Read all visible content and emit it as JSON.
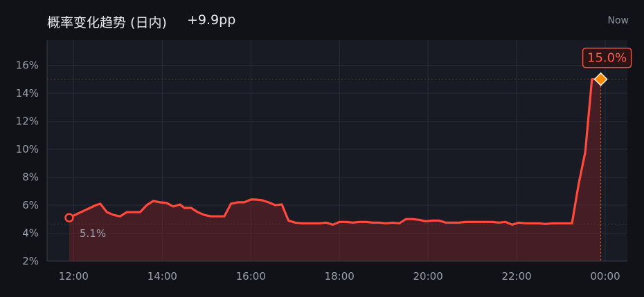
{
  "header": {
    "title": "概率变化趋势 (日内)",
    "delta": "+9.9pp",
    "now_label": "Now"
  },
  "colors": {
    "background": "#111217",
    "plot_background": "#181a24",
    "line": "#ff4a3d",
    "fill": "#7a2426",
    "end_marker": "#ff8a00",
    "grid": "#2a2d38",
    "text": "#9aa0ab"
  },
  "chart_data": {
    "type": "area",
    "title": "概率变化趋势 (日内)",
    "xlabel": "",
    "ylabel": "",
    "x_range_hours": [
      11.4,
      24.5
    ],
    "ylim": [
      2,
      17.8
    ],
    "y_ticks": [
      "2%",
      "4%",
      "6%",
      "8%",
      "10%",
      "12%",
      "14%",
      "16%"
    ],
    "y_tick_values": [
      2,
      4,
      6,
      8,
      10,
      12,
      14,
      16
    ],
    "x_ticks": [
      "12:00",
      "14:00",
      "16:00",
      "18:00",
      "20:00",
      "22:00",
      "00:00"
    ],
    "x_tick_values": [
      12,
      14,
      16,
      18,
      20,
      22,
      24
    ],
    "grid": true,
    "start_label": "5.1%",
    "end_label": "15.0%",
    "series": [
      {
        "x": [
          11.9,
          12.1,
          12.3,
          12.5,
          12.6,
          12.75,
          12.9,
          13.05,
          13.2,
          13.35,
          13.5,
          13.65,
          13.8,
          13.95,
          14.1,
          14.25,
          14.4,
          14.5,
          14.65,
          14.8,
          14.95,
          15.1,
          15.25,
          15.4,
          15.55,
          15.7,
          15.85,
          16.0,
          16.1,
          16.25,
          16.4,
          16.55,
          16.7,
          16.85,
          17.0,
          17.15,
          17.25,
          17.4,
          17.55,
          17.7,
          17.85,
          18.0,
          18.15,
          18.3,
          18.45,
          18.6,
          18.75,
          18.9,
          19.05,
          19.2,
          19.35,
          19.5,
          19.65,
          19.8,
          19.95,
          20.1,
          20.25,
          20.4,
          20.55,
          20.7,
          20.85,
          21.0,
          21.15,
          21.3,
          21.45,
          21.6,
          21.75,
          21.9,
          22.05,
          22.2,
          22.35,
          22.5,
          22.65,
          22.8,
          22.95,
          23.1,
          23.25,
          23.4,
          23.55,
          23.7,
          23.85,
          23.9
        ],
        "values": [
          5.1,
          5.4,
          5.7,
          6.0,
          6.1,
          5.5,
          5.3,
          5.2,
          5.5,
          5.5,
          5.5,
          6.0,
          6.3,
          6.2,
          6.15,
          5.9,
          6.05,
          5.8,
          5.8,
          5.5,
          5.3,
          5.2,
          5.2,
          5.2,
          6.1,
          6.2,
          6.2,
          6.4,
          6.4,
          6.35,
          6.2,
          6.0,
          6.05,
          4.9,
          4.75,
          4.7,
          4.7,
          4.7,
          4.7,
          4.75,
          4.6,
          4.8,
          4.8,
          4.75,
          4.8,
          4.8,
          4.75,
          4.75,
          4.7,
          4.75,
          4.7,
          5.0,
          5.0,
          4.95,
          4.85,
          4.9,
          4.9,
          4.75,
          4.75,
          4.75,
          4.8,
          4.8,
          4.8,
          4.8,
          4.8,
          4.75,
          4.8,
          4.6,
          4.75,
          4.7,
          4.7,
          4.7,
          4.65,
          4.7,
          4.7,
          4.7,
          4.7,
          7.5,
          9.8,
          15.0,
          15.0,
          15.0
        ]
      }
    ]
  }
}
